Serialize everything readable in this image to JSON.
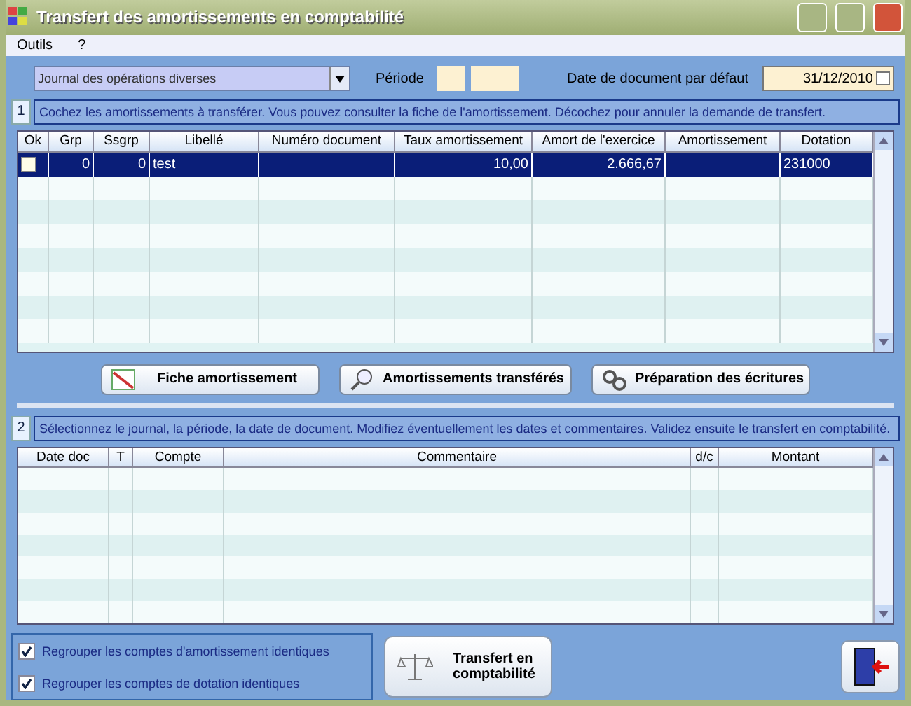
{
  "window": {
    "title": "Transfert des amortissements en comptabilité"
  },
  "menu": [
    "Outils",
    "?"
  ],
  "journal": {
    "value": "Journal des opérations diverses"
  },
  "period": {
    "label": "Période"
  },
  "default_date": {
    "label": "Date de document par défaut",
    "value": "31/12/2010"
  },
  "step1": {
    "number": "1",
    "text": "Cochez les amortissements à transférer. Vous pouvez consulter la fiche de l'amortissement. Décochez pour annuler la demande de transfert."
  },
  "grid1": {
    "columns": [
      "Ok",
      "Grp",
      "Ssgrp",
      "Libellé",
      "Numéro document",
      "Taux amortissement",
      "Amort de l'exercice",
      "Amortissement",
      "Dotation"
    ],
    "rows": [
      {
        "checked": false,
        "selected": true,
        "cells": [
          "",
          "0",
          "0",
          "test",
          "",
          "10,00",
          "2.666,67",
          "",
          "231000"
        ]
      }
    ]
  },
  "actions": [
    {
      "kind": "chart",
      "label": "Fiche amortissement"
    },
    {
      "kind": "search",
      "label": "Amortissements transférés"
    },
    {
      "kind": "gears",
      "label": "Préparation des écritures"
    }
  ],
  "step2": {
    "number": "2",
    "text": "Sélectionnez le journal, la période, la date de document. Modifiez éventuellement les dates et commentaires. Validez ensuite le transfert en comptabilité."
  },
  "grid2": {
    "columns": [
      "Date doc",
      "T",
      "Compte",
      "Commentaire",
      "d/c",
      "Montant"
    ]
  },
  "options": [
    {
      "label": "Regrouper les comptes d'amortissement identiques",
      "checked": true
    },
    {
      "label": "Regrouper les comptes de dotation identiques",
      "checked": true
    }
  ],
  "transfer_button": {
    "label": "Transfert en comptabilité"
  }
}
